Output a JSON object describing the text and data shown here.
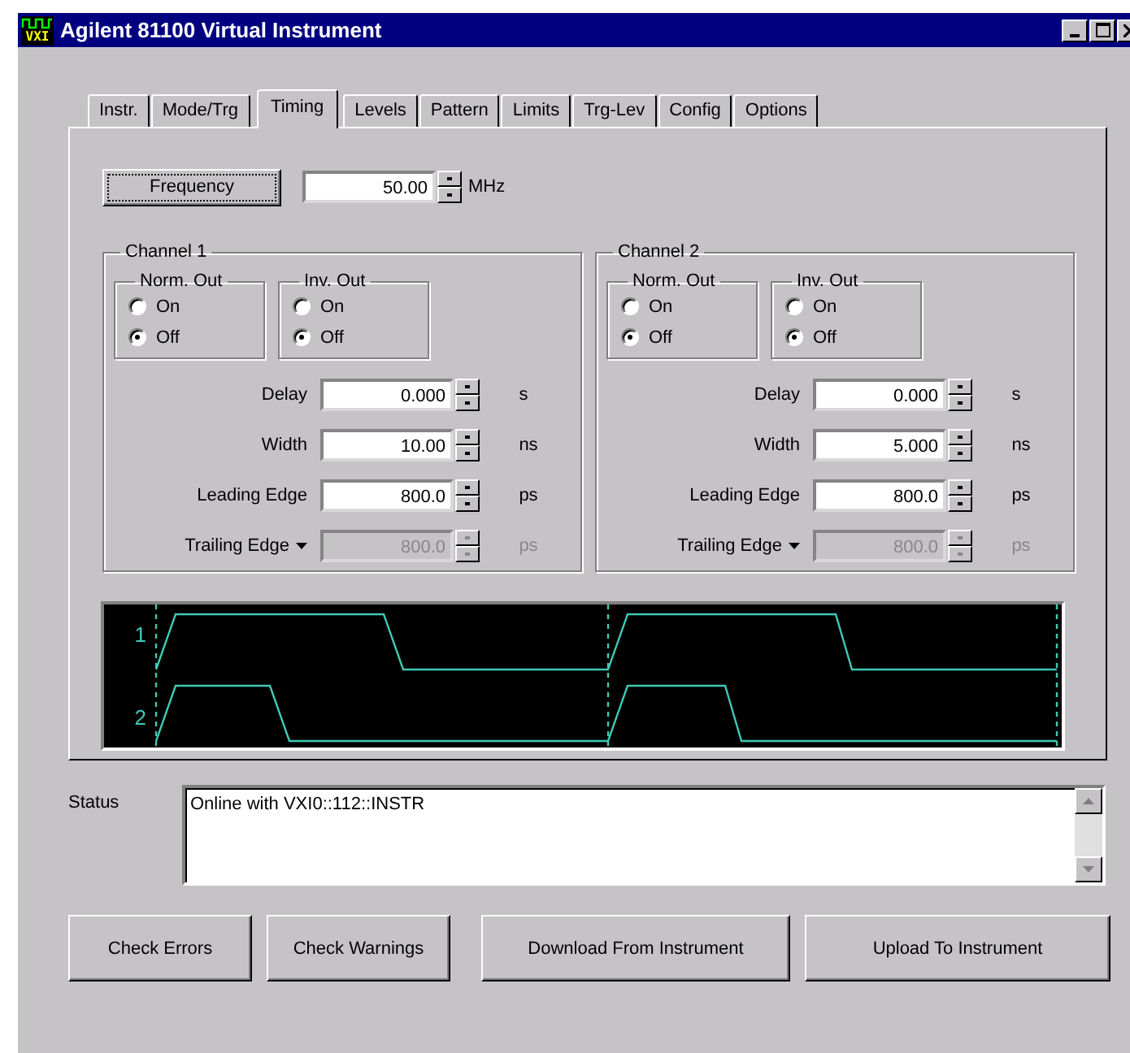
{
  "window": {
    "icon_text": "VXI",
    "title": "Agilent 81100 Virtual Instrument"
  },
  "tabs": [
    {
      "label": "Instr.",
      "selected": false
    },
    {
      "label": "Mode/Trg",
      "selected": false
    },
    {
      "label": "Timing",
      "selected": true
    },
    {
      "label": "Levels",
      "selected": false
    },
    {
      "label": "Pattern",
      "selected": false
    },
    {
      "label": "Limits",
      "selected": false
    },
    {
      "label": "Trg-Lev",
      "selected": false
    },
    {
      "label": "Config",
      "selected": false
    },
    {
      "label": "Options",
      "selected": false
    }
  ],
  "frequency": {
    "button": "Frequency",
    "value": "50.00",
    "unit": "MHz"
  },
  "channels": [
    {
      "title": "Channel 1",
      "outputs": [
        {
          "title": "Norm. Out",
          "options": [
            {
              "label": "On",
              "selected": false
            },
            {
              "label": "Off",
              "selected": true
            }
          ]
        },
        {
          "title": "Inv. Out",
          "options": [
            {
              "label": "On",
              "selected": false
            },
            {
              "label": "Off",
              "selected": true
            }
          ]
        }
      ],
      "rows": [
        {
          "kind": "field",
          "label": "Delay",
          "value": "0.000",
          "unit": "s",
          "disabled": false
        },
        {
          "kind": "field",
          "label": "Width",
          "value": "10.00",
          "unit": "ns",
          "disabled": false
        },
        {
          "kind": "field",
          "label": "Leading Edge",
          "value": "800.0",
          "unit": "ps",
          "disabled": false
        },
        {
          "kind": "dropdown",
          "label": "Trailing Edge",
          "value": "800.0",
          "unit": "ps",
          "disabled": true
        }
      ]
    },
    {
      "title": "Channel 2",
      "outputs": [
        {
          "title": "Norm. Out",
          "options": [
            {
              "label": "On",
              "selected": false
            },
            {
              "label": "Off",
              "selected": true
            }
          ]
        },
        {
          "title": "Inv. Out",
          "options": [
            {
              "label": "On",
              "selected": false
            },
            {
              "label": "Off",
              "selected": true
            }
          ]
        }
      ],
      "rows": [
        {
          "kind": "field",
          "label": "Delay",
          "value": "0.000",
          "unit": "s",
          "disabled": false
        },
        {
          "kind": "field",
          "label": "Width",
          "value": "5.000",
          "unit": "ns",
          "disabled": false
        },
        {
          "kind": "field",
          "label": "Leading Edge",
          "value": "800.0",
          "unit": "ps",
          "disabled": false
        },
        {
          "kind": "dropdown",
          "label": "Trailing Edge",
          "value": "800.0",
          "unit": "ps",
          "disabled": true
        }
      ]
    }
  ],
  "waveform": {
    "labels": [
      "1",
      "2"
    ]
  },
  "status": {
    "label": "Status",
    "text": "Online with VXI0::112::INSTR"
  },
  "buttons": [
    "Check Errors",
    "Check Warnings",
    "Download From Instrument",
    "Upload To Instrument"
  ]
}
